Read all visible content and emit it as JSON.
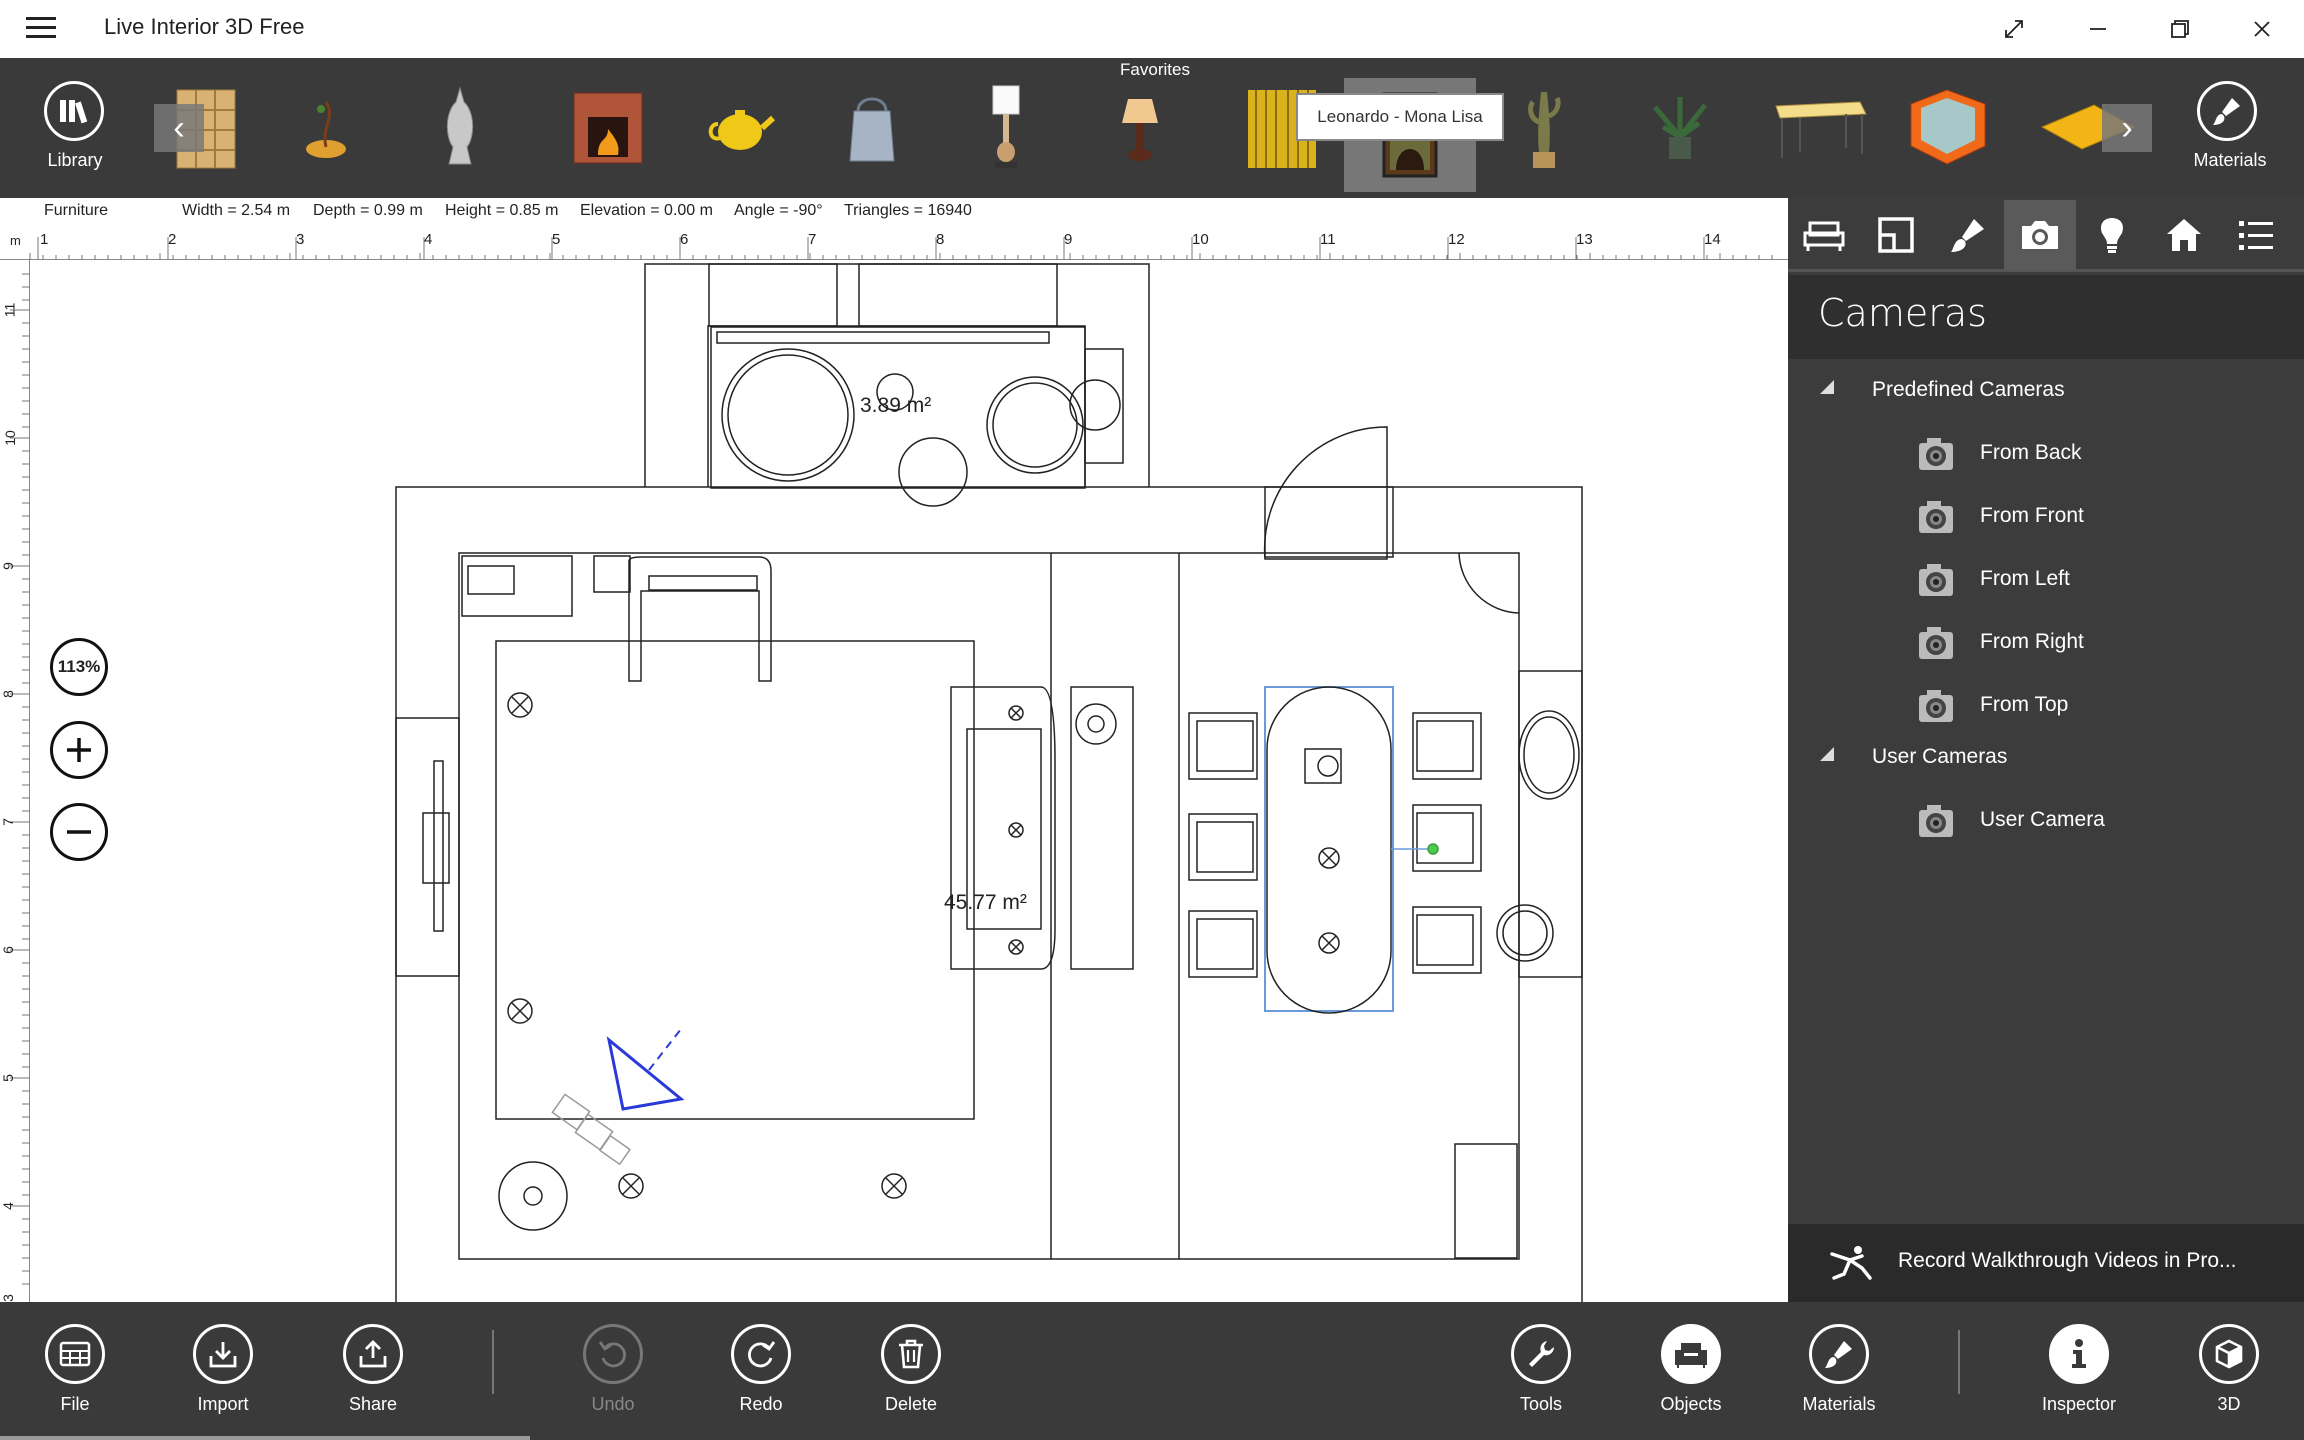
{
  "app": {
    "title": "Live Interior 3D Free"
  },
  "top_toolbar": {
    "library_label": "Library",
    "materials_label": "Materials",
    "favorites_label": "Favorites",
    "tooltip": "Leonardo - Mona Lisa"
  },
  "info_bar": {
    "category": "Furniture",
    "width": "Width = 2.54 m",
    "depth": "Depth = 0.99 m",
    "height": "Height = 0.85 m",
    "elevation": "Elevation = 0.00 m",
    "angle": "Angle = -90°",
    "triangles": "Triangles = 16940"
  },
  "ruler": {
    "unit": "m",
    "top_ticks": [
      "1",
      "2",
      "3",
      "4",
      "5",
      "6",
      "7",
      "8",
      "9",
      "10",
      "11",
      "12",
      "13",
      "14"
    ],
    "left_ticks": [
      "11",
      "10",
      "9",
      "8",
      "7",
      "6",
      "5",
      "4",
      "3"
    ]
  },
  "plan": {
    "room1_area": "45.77 m²",
    "room2_area": "3.89 m²"
  },
  "zoom": {
    "level": "113%"
  },
  "panel": {
    "title": "Cameras",
    "predefined_group": "Predefined Cameras",
    "predefined": [
      "From Back",
      "From Front",
      "From Left",
      "From Right",
      "From Top"
    ],
    "user_group": "User Cameras",
    "user": [
      "User Camera"
    ],
    "record_text": "Record Walkthrough Videos in Pro..."
  },
  "bottom_toolbar": {
    "file": "File",
    "import": "Import",
    "share": "Share",
    "undo": "Undo",
    "redo": "Redo",
    "delete": "Delete",
    "tools": "Tools",
    "objects": "Objects",
    "materials": "Materials",
    "inspector": "Inspector",
    "threed": "3D"
  }
}
